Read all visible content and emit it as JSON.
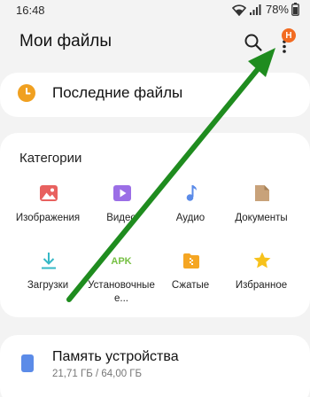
{
  "status_bar": {
    "time": "16:48",
    "battery": "78%",
    "icons": [
      "wifi-icon",
      "signal-icon",
      "battery-icon"
    ]
  },
  "header": {
    "title": "Мои файлы",
    "search_icon": "search-icon",
    "more_icon": "more-vert-icon",
    "badge": "Н",
    "badge_color": "#f26b21"
  },
  "recent": {
    "label": "Последние файлы",
    "icon": "clock-icon",
    "icon_color": "#f0a020"
  },
  "categories": {
    "title": "Категории",
    "items": [
      {
        "label": "Изображения",
        "icon": "image-icon",
        "color": "#e8615f"
      },
      {
        "label": "Видео",
        "icon": "video-icon",
        "color": "#9b6ee6"
      },
      {
        "label": "Аудио",
        "icon": "audio-icon",
        "color": "#5b8be8"
      },
      {
        "label": "Документы",
        "icon": "document-icon",
        "color": "#c8a27a"
      },
      {
        "label": "Загрузки",
        "icon": "download-icon",
        "color": "#35b8c6"
      },
      {
        "label": "Установочные е...",
        "icon": "apk-icon",
        "color": "#76c043"
      },
      {
        "label": "Сжатые",
        "icon": "archive-icon",
        "color": "#f5a623"
      },
      {
        "label": "Избранное",
        "icon": "star-icon",
        "color": "#f7c21c"
      }
    ]
  },
  "storage": {
    "label": "Память устройства",
    "size": "21,71 ГБ / 64,00 ГБ",
    "icon": "phone-storage-icon",
    "icon_color": "#5b8be8"
  },
  "annotation": {
    "arrow_color": "#1f8c1f"
  }
}
